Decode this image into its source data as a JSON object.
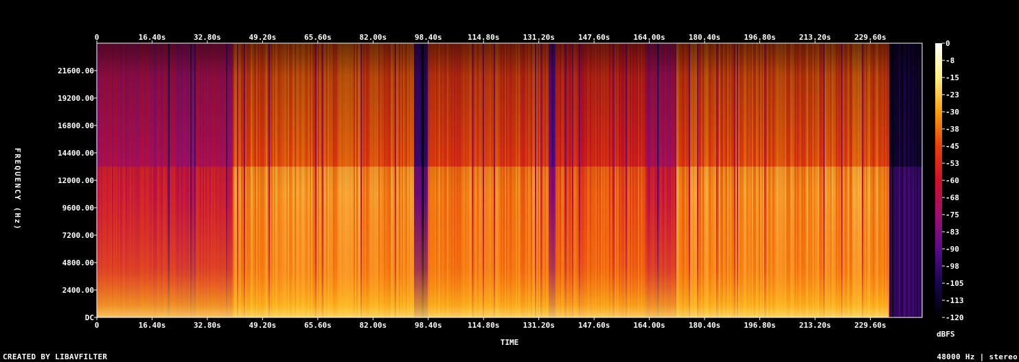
{
  "chart_data": {
    "type": "heatmap",
    "title": "",
    "xlabel": "TIME",
    "ylabel": "FREQUENCY (Hz)",
    "x_ticks": [
      "0",
      "16.40s",
      "32.80s",
      "49.20s",
      "65.60s",
      "82.00s",
      "98.40s",
      "114.80s",
      "131.20s",
      "147.60s",
      "164.00s",
      "180.40s",
      "196.80s",
      "213.20s",
      "229.60s"
    ],
    "x_tick_values": [
      0,
      16.4,
      32.8,
      49.2,
      65.6,
      82.0,
      98.4,
      114.8,
      131.2,
      147.6,
      164.0,
      180.4,
      196.8,
      213.2,
      229.6
    ],
    "xlim": [
      0,
      245
    ],
    "y_ticks": [
      "DC",
      "2400.00",
      "4800.00",
      "7200.00",
      "9600.00",
      "12000.00",
      "14400.00",
      "16800.00",
      "19200.00",
      "21600.00"
    ],
    "y_tick_values": [
      0,
      2400,
      4800,
      7200,
      9600,
      12000,
      14400,
      16800,
      19200,
      21600
    ],
    "ylim": [
      0,
      24000
    ],
    "colorbar": {
      "label": "dBFS",
      "ticks": [
        "0",
        "-8",
        "-15",
        "-23",
        "-30",
        "-38",
        "-45",
        "-53",
        "-60",
        "-68",
        "-75",
        "-83",
        "-90",
        "-98",
        "-105",
        "-113",
        "-120"
      ],
      "range": [
        -120,
        0
      ],
      "colors": [
        "#000000",
        "#1a0550",
        "#5a0c8c",
        "#a01070",
        "#d01028",
        "#e8400c",
        "#f8a010",
        "#fff080",
        "#ffffff"
      ]
    },
    "segments": [
      {
        "start": 0,
        "end": 40,
        "level": 0.55
      },
      {
        "start": 40,
        "end": 94,
        "level": 0.78
      },
      {
        "start": 94,
        "end": 98,
        "level": 0.3
      },
      {
        "start": 98,
        "end": 134,
        "level": 0.75
      },
      {
        "start": 134,
        "end": 136,
        "level": 0.4
      },
      {
        "start": 136,
        "end": 163,
        "level": 0.7
      },
      {
        "start": 163,
        "end": 172,
        "level": 0.55
      },
      {
        "start": 172,
        "end": 235,
        "level": 0.78
      },
      {
        "start": 235,
        "end": 245,
        "level": 0.22
      }
    ]
  },
  "footer": {
    "left": "CREATED BY LIBAVFILTER",
    "right": "48000 Hz | stereo"
  }
}
